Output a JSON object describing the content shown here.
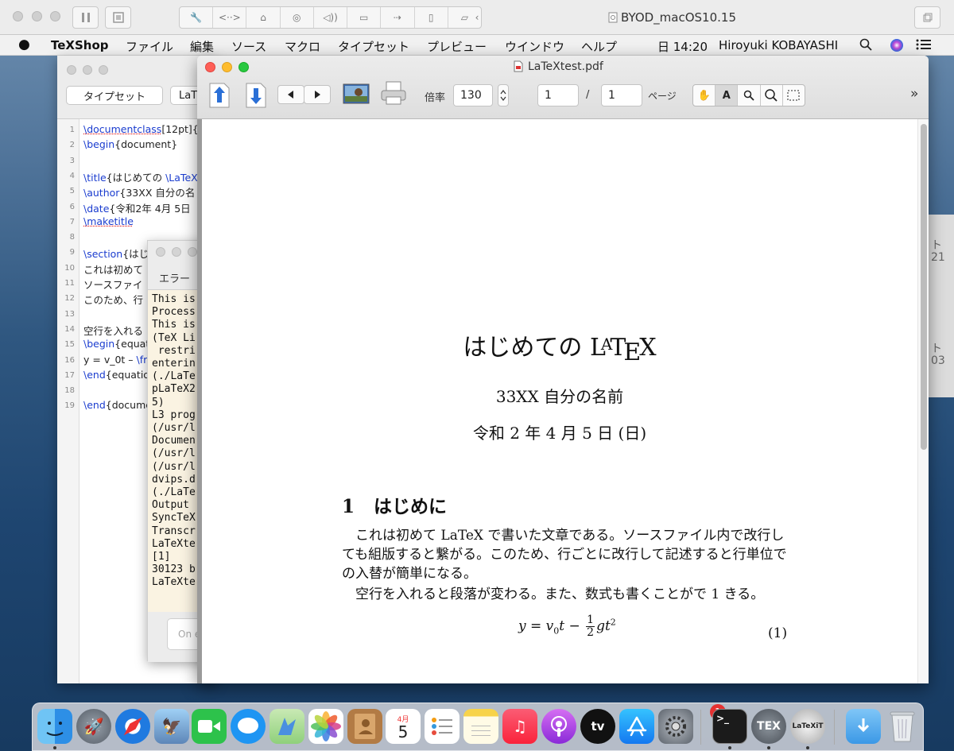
{
  "vm": {
    "title": "BYOD_macOS10.15",
    "toolbar_icons": [
      "pause-icon",
      "snapshot-icon",
      "settings-wrench-icon",
      "code-icon",
      "drive-icon",
      "camera-icon",
      "speaker-icon",
      "video-icon",
      "usb-icon",
      "phone-icon",
      "shared-folder-icon",
      "arrow-left-icon",
      "fullscreen-icon"
    ]
  },
  "menubar": {
    "app": "TeXShop",
    "items": [
      "ファイル",
      "編集",
      "ソース",
      "マクロ",
      "タイプセット",
      "プレビュー",
      "ウインドウ",
      "ヘルプ"
    ],
    "clock": "日 14:20",
    "user": "Hiroyuki KOBAYASHI"
  },
  "editor": {
    "typeset_button": "タイプセット",
    "format_button": "LaT",
    "lines": [
      {
        "n": "1",
        "segments": [
          {
            "t": "\\documentclass",
            "c": "cmd"
          },
          {
            "t": "[12pt]{j",
            "c": "arg"
          }
        ]
      },
      {
        "n": "2",
        "segments": [
          {
            "t": "\\begin",
            "c": "cmd"
          },
          {
            "t": "{document}",
            "c": "arg"
          }
        ]
      },
      {
        "n": "3",
        "segments": []
      },
      {
        "n": "4",
        "segments": [
          {
            "t": "\\title",
            "c": "cmd"
          },
          {
            "t": "{はじめての ",
            "c": "arg"
          },
          {
            "t": "\\LaTeX",
            "c": "cmd"
          }
        ]
      },
      {
        "n": "5",
        "segments": [
          {
            "t": "\\author",
            "c": "cmd"
          },
          {
            "t": "{33XX 自分の名",
            "c": "arg"
          }
        ]
      },
      {
        "n": "6",
        "segments": [
          {
            "t": "\\date",
            "c": "cmd"
          },
          {
            "t": "{令和2年 4月 5日",
            "c": "arg"
          }
        ]
      },
      {
        "n": "7",
        "segments": [
          {
            "t": "\\maketitle",
            "c": "cmd"
          }
        ]
      },
      {
        "n": "8",
        "segments": []
      },
      {
        "n": "9",
        "segments": [
          {
            "t": "\\section",
            "c": "cmd"
          },
          {
            "t": "{はじ",
            "c": "arg"
          }
        ]
      },
      {
        "n": "10",
        "segments": [
          {
            "t": "これは初めて",
            "c": "arg"
          }
        ]
      },
      {
        "n": "11",
        "segments": [
          {
            "t": "ソースファイ",
            "c": "arg"
          }
        ]
      },
      {
        "n": "12",
        "segments": [
          {
            "t": "このため、行",
            "c": "arg"
          }
        ]
      },
      {
        "n": "13",
        "segments": []
      },
      {
        "n": "14",
        "segments": [
          {
            "t": "空行を入れる",
            "c": "arg"
          }
        ]
      },
      {
        "n": "15",
        "segments": [
          {
            "t": "\\begin",
            "c": "cmd"
          },
          {
            "t": "{equati",
            "c": "arg"
          }
        ]
      },
      {
        "n": "16",
        "segments": [
          {
            "t": "y = v_0t – ",
            "c": "arg"
          },
          {
            "t": "\\fra",
            "c": "cmd"
          }
        ]
      },
      {
        "n": "17",
        "segments": [
          {
            "t": "\\end",
            "c": "cmd"
          },
          {
            "t": "{equation",
            "c": "arg"
          }
        ]
      },
      {
        "n": "18",
        "segments": []
      },
      {
        "n": "19",
        "segments": [
          {
            "t": "\\end",
            "c": "cmd"
          },
          {
            "t": "{docume",
            "c": "arg"
          }
        ]
      }
    ]
  },
  "console": {
    "tab": "エラー",
    "log": [
      "This is",
      "Process",
      "This is",
      "(TeX Li",
      " restri",
      "enterin",
      "(./LaTe",
      "pLaTeX2",
      "5)",
      "L3 prog",
      "(/usr/l",
      "Documen",
      "(/usr/l",
      "(/usr/l",
      "dvips.d",
      "(./LaTe",
      "Output ",
      "SyncTeX",
      "Transcr",
      "LaTeXte",
      "[1]",
      "30123 b",
      "LaTeXte"
    ],
    "input_placeholder": "On e"
  },
  "pdf": {
    "window_title": "LaTeXtest.pdf",
    "zoom_label": "倍率",
    "zoom_value": "130",
    "page_current": "1",
    "page_sep": "/",
    "page_total": "1",
    "page_label": "ページ",
    "text_tool": "A",
    "more": "»"
  },
  "document": {
    "title_prefix": "はじめての ",
    "title_latex": "LaTeX",
    "author": "33XX 自分の名前",
    "date": "令和 2 年 4 月 5 日 (日)",
    "section_number": "1",
    "section_title": "はじめに",
    "paragraph1": "これは初めて LaTeX で書いた文章である。ソースファイル内で改行しても組版すると繋がる。このため、行ごとに改行して記述すると行単位での入替が簡単になる。",
    "paragraph2": "空行を入れると段落が変わる。また、数式も書くことがで 1 きる。",
    "equation_lhs": "y = v",
    "equation_sub0": "0",
    "equation_t": "t − ",
    "equation_frac_num": "1",
    "equation_frac_den": "2",
    "equation_rest": "gt",
    "equation_exp": "2",
    "equation_number": "(1)"
  },
  "side_window": {
    "line1": "ト",
    "line2": "21",
    "line3": "ト",
    "line4": "03"
  },
  "dock": {
    "calendar_month": "4月",
    "calendar_day": "5",
    "appletv_label": "tv",
    "badge_count": "1",
    "tex_label": "TEX",
    "latexit_label": "LaTeXiT",
    "terminal_prompt": ">_"
  }
}
